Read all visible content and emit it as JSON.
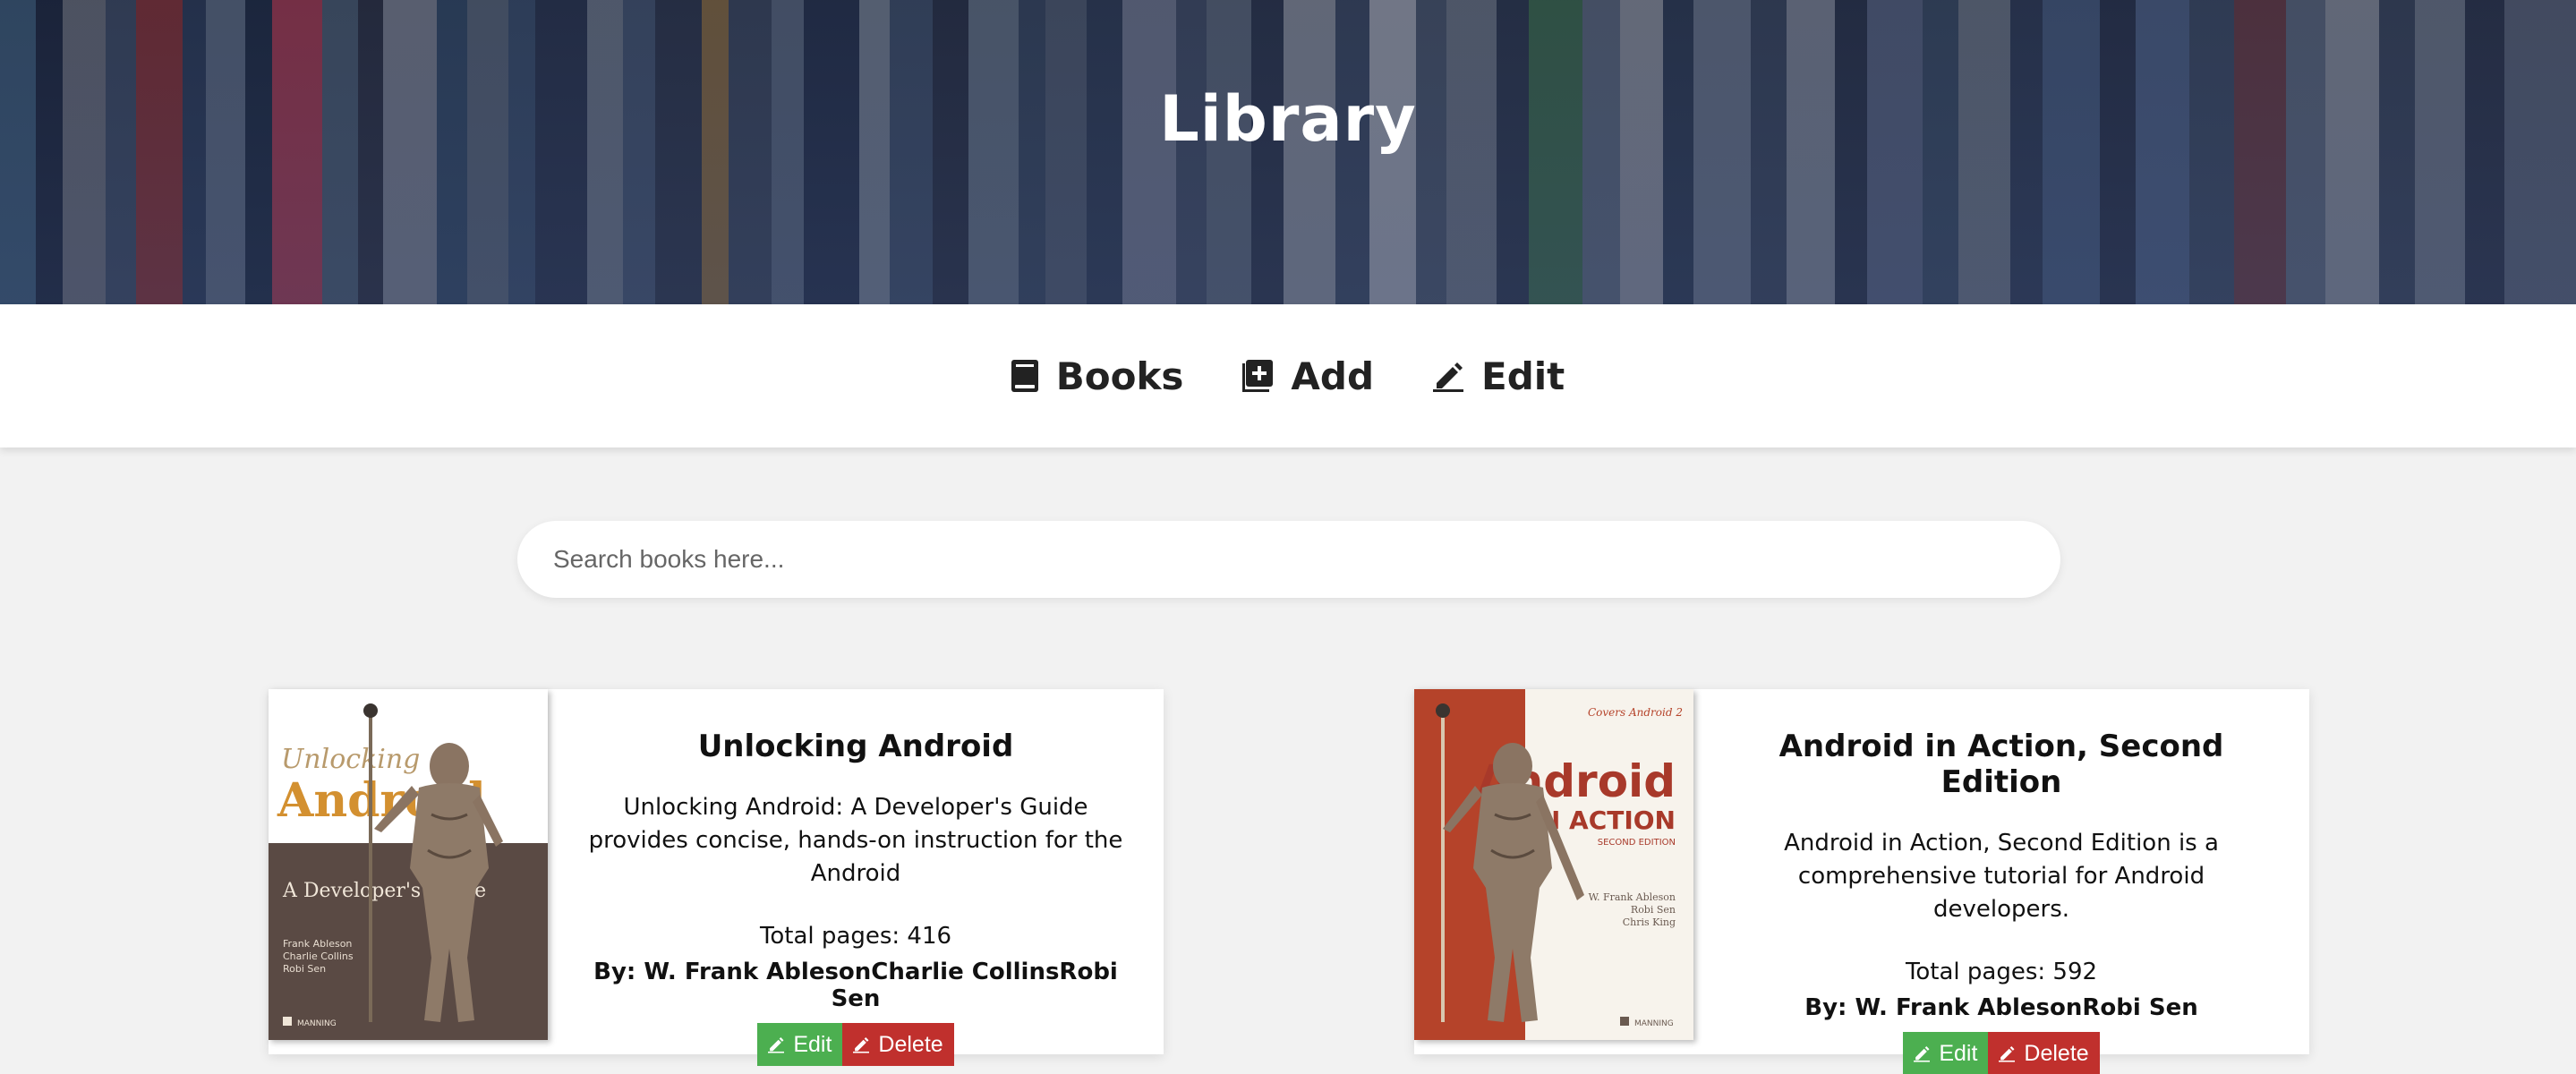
{
  "header": {
    "title": "Library"
  },
  "nav": {
    "items": [
      {
        "label": "Books",
        "icon": "book-icon"
      },
      {
        "label": "Add",
        "icon": "add-box-icon"
      },
      {
        "label": "Edit",
        "icon": "pencil-icon"
      }
    ]
  },
  "search": {
    "placeholder": "Search books here...",
    "value": ""
  },
  "books": [
    {
      "title": "Unlocking Android",
      "description": "Unlocking Android: A Developer's Guide provides concise, hands-on instruction for the Android",
      "pages_text": "Total pages: 416",
      "authors_text": "By: W. Frank AblesonCharlie CollinsRobi Sen",
      "edit_label": "Edit",
      "delete_label": "Delete",
      "cover": {
        "line1": "Unlocking",
        "line2": "Android",
        "subtitle": "A Developer's Guide",
        "authors": [
          "Frank Ableson",
          "Charlie Collins",
          "Robi Sen"
        ],
        "publisher": "MANNING"
      }
    },
    {
      "title": "Android in Action, Second Edition",
      "description": "Android in Action, Second Edition is a comprehensive tutorial for Android developers.",
      "pages_text": "Total pages: 592",
      "authors_text": "By: W. Frank AblesonRobi Sen",
      "edit_label": "Edit",
      "delete_label": "Delete",
      "cover": {
        "tagline": "Covers Android 2",
        "line1": "Android",
        "line2": "IN ACTION",
        "edition": "SECOND EDITION",
        "authors": [
          "W. Frank Ableson",
          "Robi Sen",
          "Chris King"
        ],
        "publisher": "MANNING"
      }
    }
  ],
  "colors": {
    "edit_button": "#4caf50",
    "delete_button": "#c0302d",
    "page_background": "#f2f2f2",
    "cover1_brown": "#5a4a44",
    "cover1_orange": "#d39030",
    "cover2_red": "#b5432a"
  }
}
